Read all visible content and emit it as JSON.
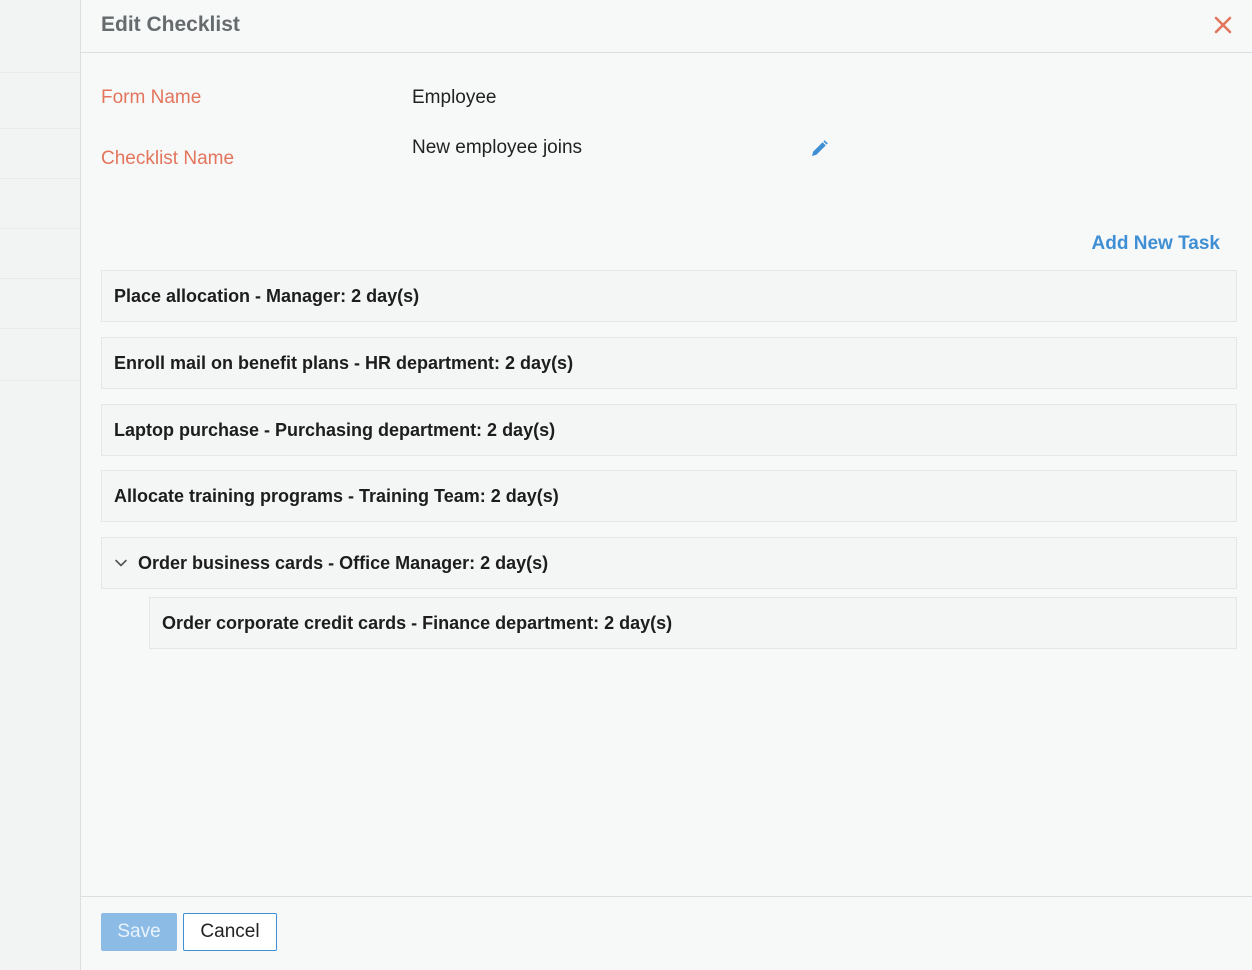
{
  "dialog": {
    "title": "Edit Checklist"
  },
  "form": {
    "form_name_label": "Form Name",
    "form_name_value": "Employee",
    "checklist_name_label": "Checklist Name",
    "checklist_name_value": "New employee joins"
  },
  "tasks": {
    "add_label": "Add New Task",
    "items": [
      {
        "text": "Place allocation - Manager: 2 day(s)"
      },
      {
        "text": "Enroll mail on benefit plans - HR department: 2 day(s)"
      },
      {
        "text": "Laptop purchase - Purchasing department: 2 day(s)"
      },
      {
        "text": "Allocate training programs - Training Team: 2 day(s)"
      },
      {
        "text": "Order business cards - Office Manager: 2 day(s)",
        "expanded": true,
        "subtasks": [
          {
            "text": "Order corporate credit cards - Finance department: 2 day(s)"
          }
        ]
      }
    ]
  },
  "footer": {
    "save_label": "Save",
    "cancel_label": "Cancel"
  },
  "colors": {
    "label_accent": "#e3755d",
    "link_blue": "#3f8fd4",
    "save_disabled": "#8cbce6",
    "close_red": "#e3755d"
  },
  "icons": {
    "close": "close-icon",
    "edit": "pencil-icon",
    "expand": "chevron-down-icon"
  }
}
